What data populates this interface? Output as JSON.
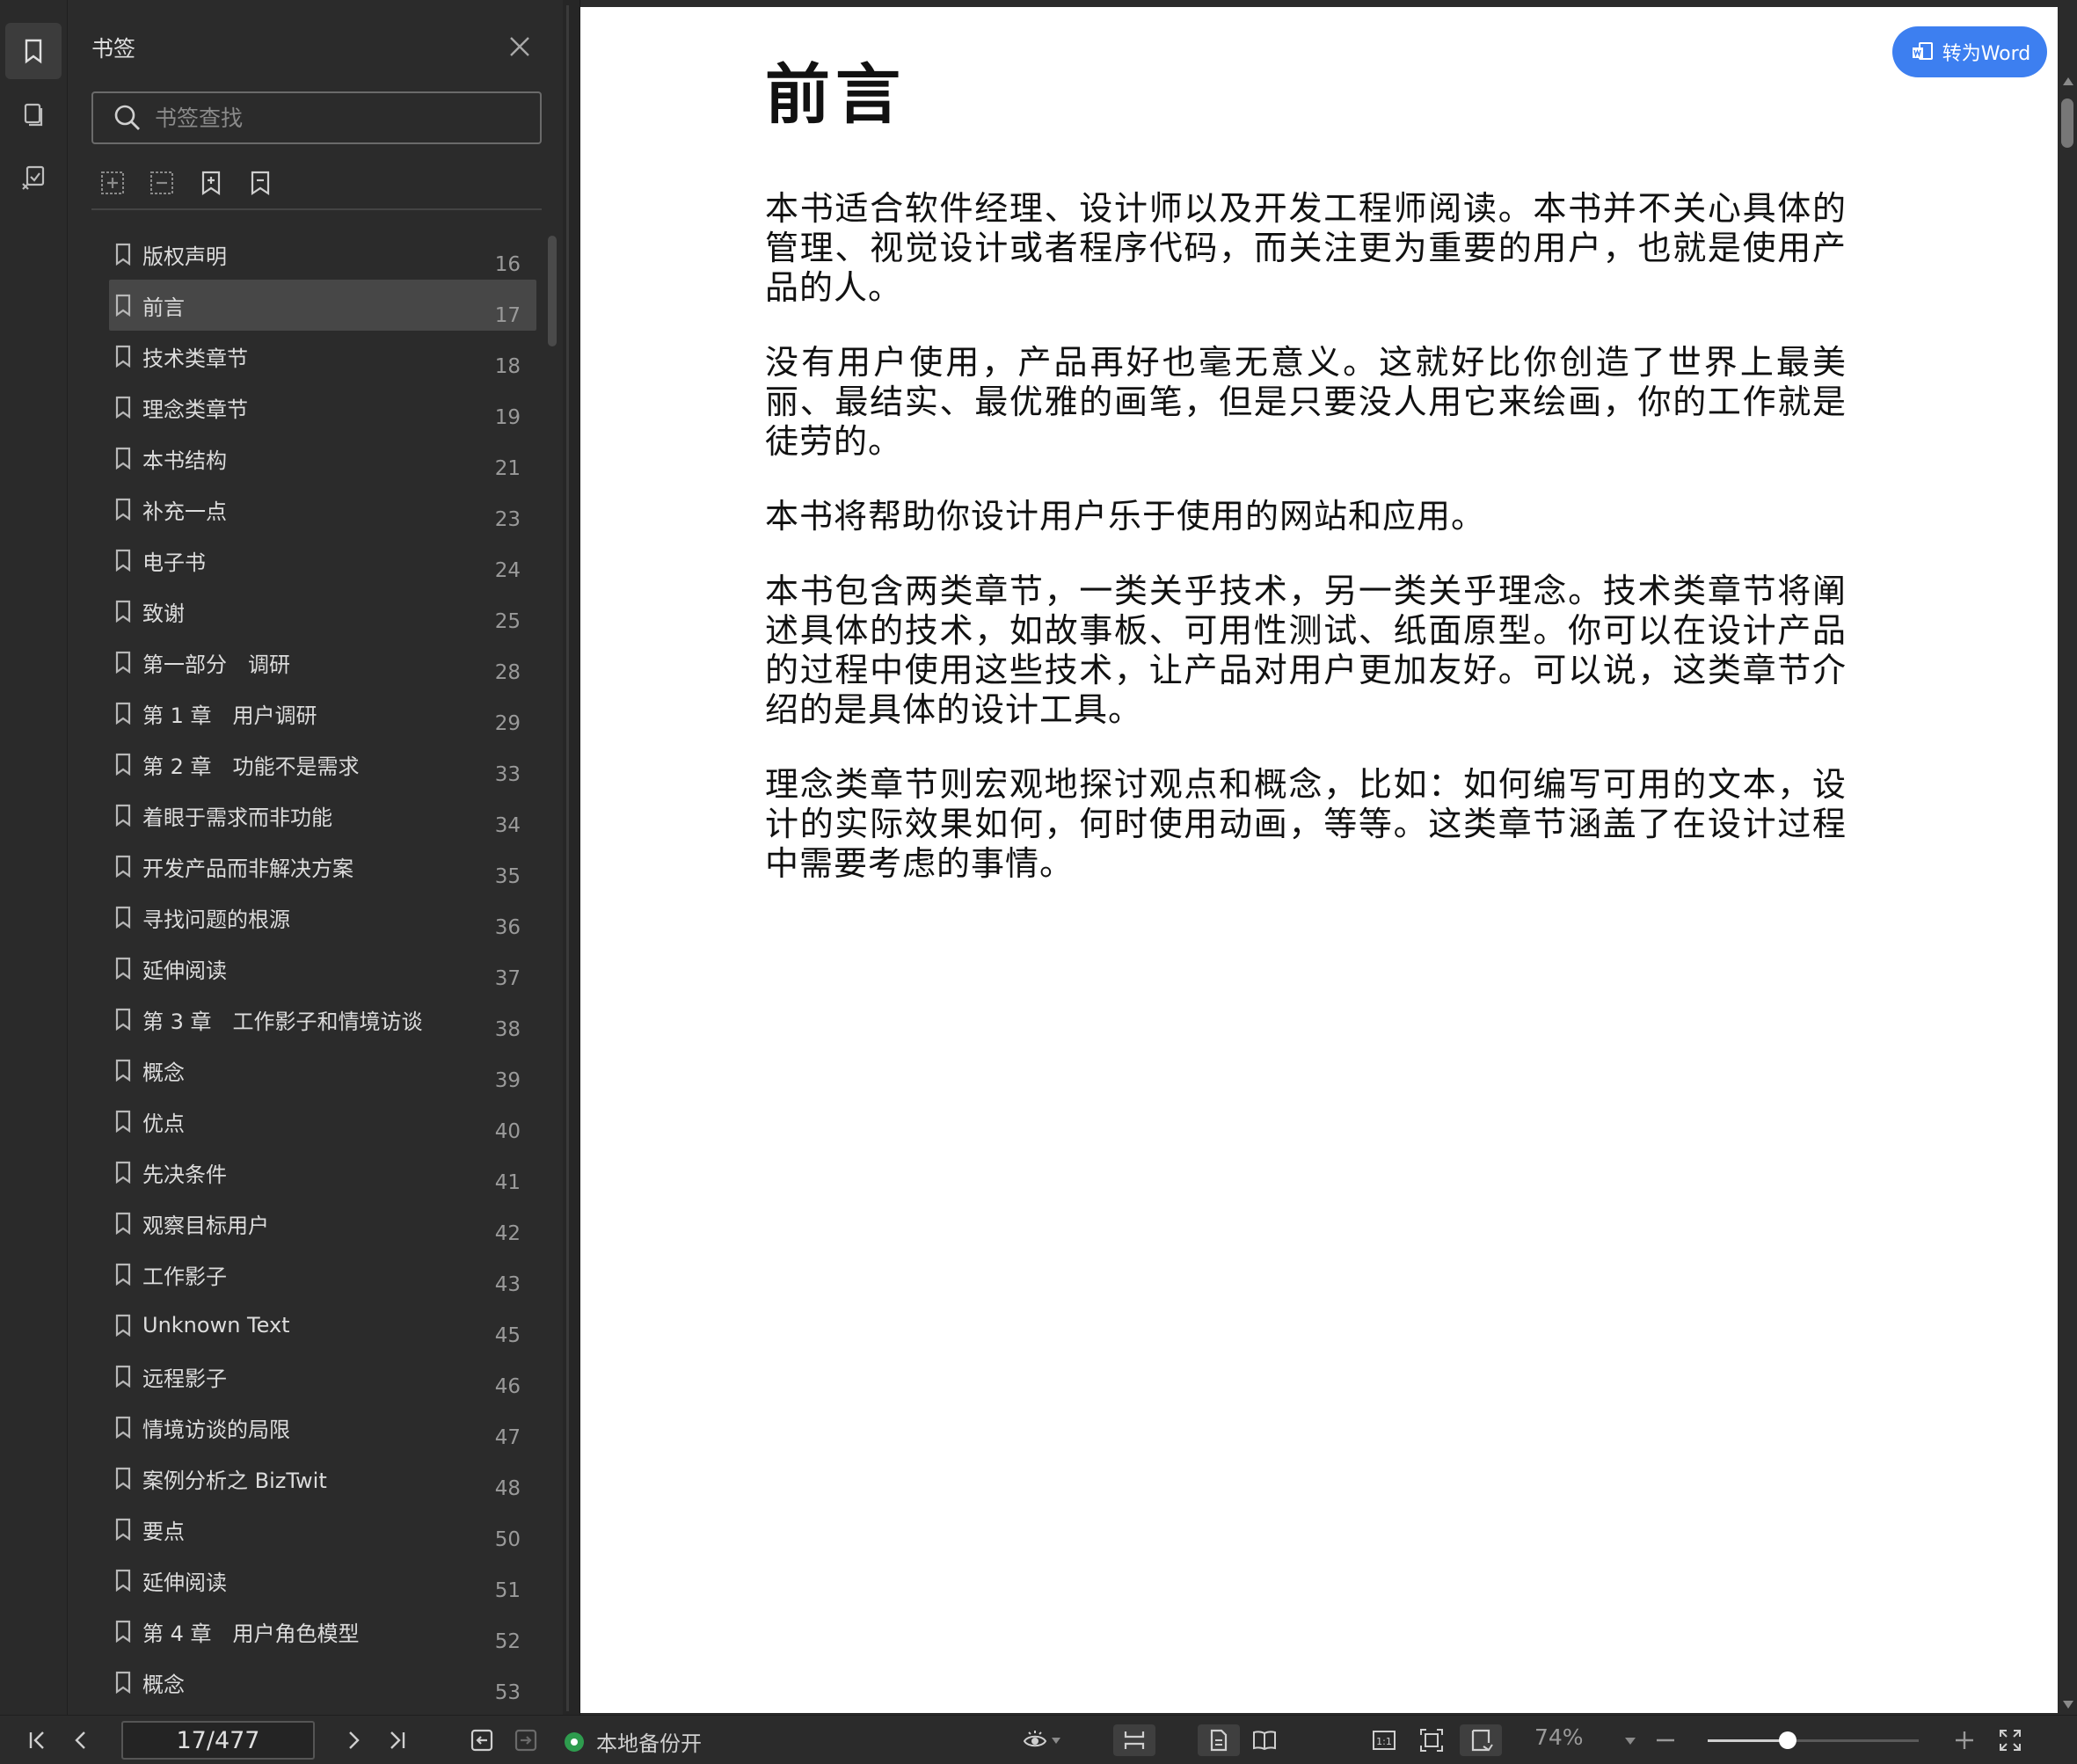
{
  "panel": {
    "title": "书签",
    "search_placeholder": "书签查找"
  },
  "bookmarks": [
    {
      "label": "版权声明",
      "page": "16"
    },
    {
      "label": "前言",
      "page": "17",
      "selected": true
    },
    {
      "label": "技术类章节",
      "page": "18"
    },
    {
      "label": "理念类章节",
      "page": "19"
    },
    {
      "label": "本书结构",
      "page": "21"
    },
    {
      "label": "补充一点",
      "page": "23"
    },
    {
      "label": "电子书",
      "page": "24"
    },
    {
      "label": "致谢",
      "page": "25"
    },
    {
      "label": "第一部分　调研",
      "page": "28"
    },
    {
      "label": "第 1 章　用户调研",
      "page": "29"
    },
    {
      "label": "第 2 章　功能不是需求",
      "page": "33"
    },
    {
      "label": "着眼于需求而非功能",
      "page": "34"
    },
    {
      "label": "开发产品而非解决方案",
      "page": "35"
    },
    {
      "label": "寻找问题的根源",
      "page": "36"
    },
    {
      "label": "延伸阅读",
      "page": "37"
    },
    {
      "label": "第 3 章　工作影子和情境访谈",
      "page": "38"
    },
    {
      "label": "概念",
      "page": "39"
    },
    {
      "label": "优点",
      "page": "40"
    },
    {
      "label": "先决条件",
      "page": "41"
    },
    {
      "label": "观察目标用户",
      "page": "42"
    },
    {
      "label": "工作影子",
      "page": "43"
    },
    {
      "label": "Unknown Text",
      "page": "45"
    },
    {
      "label": "远程影子",
      "page": "46"
    },
    {
      "label": "情境访谈的局限",
      "page": "47"
    },
    {
      "label": "案例分析之 BizTwit",
      "page": "48"
    },
    {
      "label": "要点",
      "page": "50"
    },
    {
      "label": "延伸阅读",
      "page": "51"
    },
    {
      "label": "第 4 章　用户角色模型",
      "page": "52"
    },
    {
      "label": "概念",
      "page": "53"
    }
  ],
  "document": {
    "heading": "前言",
    "paragraphs": [
      "本书适合软件经理、设计师以及开发工程师阅读。本书并不关心具体的管理、视觉设计或者程序代码，而关注更为重要的用户，也就是使用产品的人。",
      "没有用户使用，产品再好也毫无意义。这就好比你创造了世界上最美丽、最结实、最优雅的画笔，但是只要没人用它来绘画，你的工作就是徒劳的。",
      "本书将帮助你设计用户乐于使用的网站和应用。",
      "本书包含两类章节，一类关乎技术，另一类关乎理念。技术类章节将阐述具体的技术，如故事板、可用性测试、纸面原型。你可以在设计产品的过程中使用这些技术，让产品对用户更加友好。可以说，这类章节介绍的是具体的设计工具。",
      "理念类章节则宏观地探讨观点和概念，比如：如何编写可用的文本，设计的实际效果如何，何时使用动画，等等。这类章节涵盖了在设计过程中需要考虑的事情。"
    ],
    "convert_button": "转为Word"
  },
  "status": {
    "page_indicator": "17/477",
    "backup_label": "本地备份开",
    "zoom": "74%",
    "zoom_fraction": 0.38
  },
  "colors": {
    "accent": "#3d7ff0",
    "backup_on": "#2e9c4e"
  }
}
